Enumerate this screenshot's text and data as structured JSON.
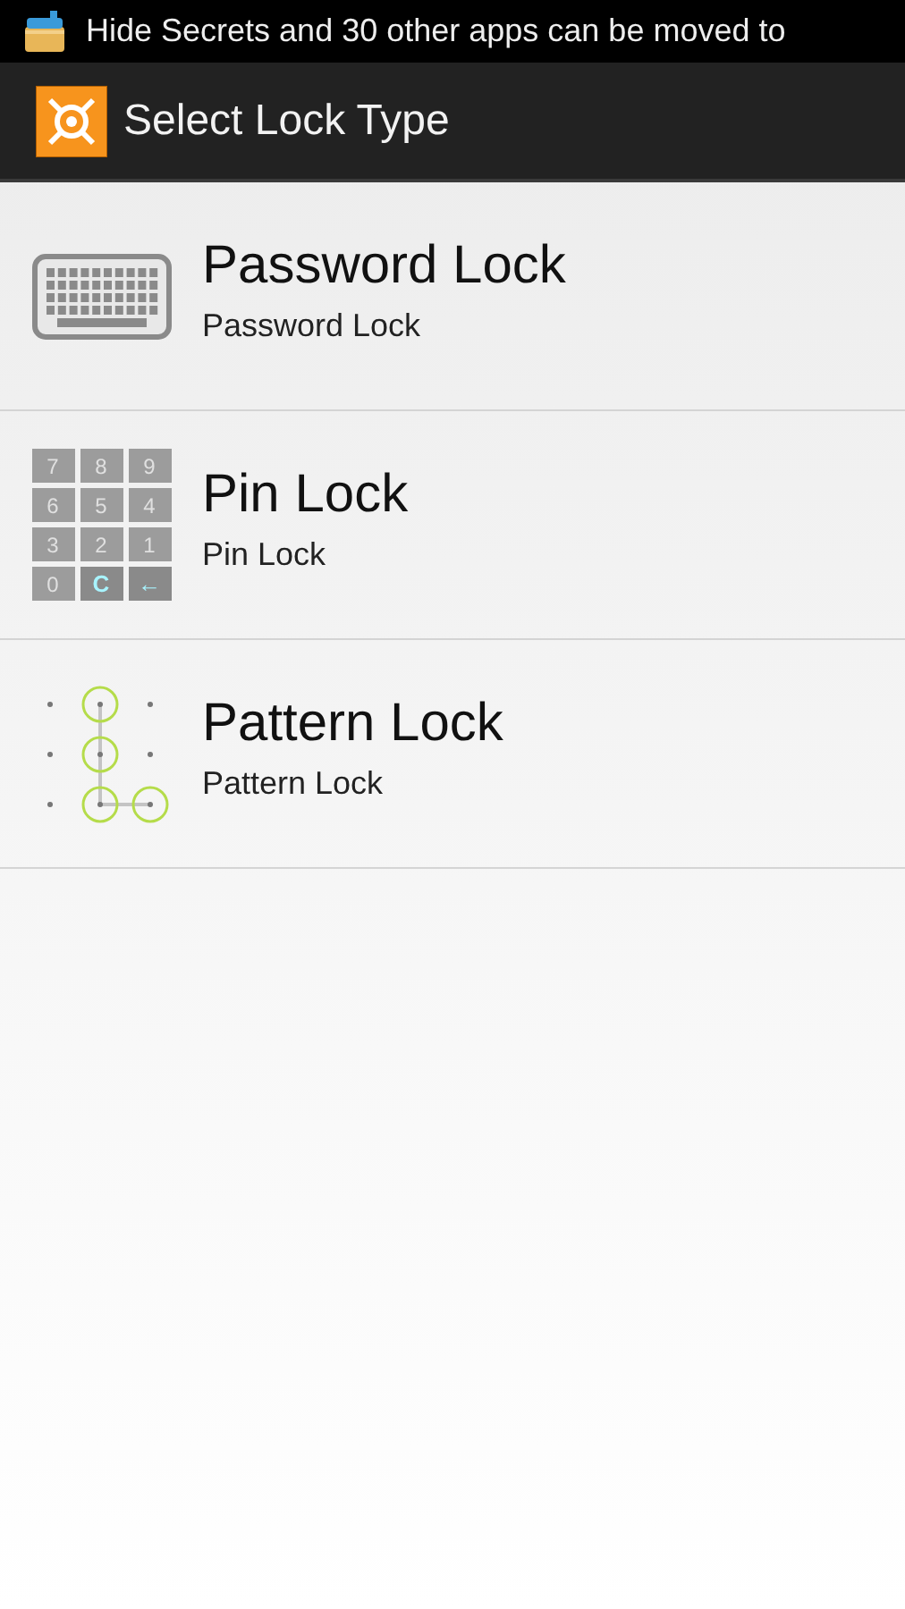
{
  "status_bar": {
    "notification": "Hide Secrets and 30 other apps can be moved to"
  },
  "action_bar": {
    "title": "Select Lock Type"
  },
  "lock_types": [
    {
      "kind": "password",
      "title": "Password Lock",
      "subtitle": "Password Lock"
    },
    {
      "kind": "pin",
      "title": "Pin Lock",
      "subtitle": "Pin Lock",
      "keys": [
        {
          "label": "7",
          "kind": "digit"
        },
        {
          "label": "8",
          "kind": "digit"
        },
        {
          "label": "9",
          "kind": "digit"
        },
        {
          "label": "6",
          "kind": "digit"
        },
        {
          "label": "5",
          "kind": "digit"
        },
        {
          "label": "4",
          "kind": "digit"
        },
        {
          "label": "3",
          "kind": "digit"
        },
        {
          "label": "2",
          "kind": "digit"
        },
        {
          "label": "1",
          "kind": "digit"
        },
        {
          "label": "0",
          "kind": "digit"
        },
        {
          "label": "C",
          "kind": "action"
        },
        {
          "label": "←",
          "kind": "action"
        }
      ]
    },
    {
      "kind": "pattern",
      "title": "Pattern Lock",
      "subtitle": "Pattern Lock"
    }
  ]
}
